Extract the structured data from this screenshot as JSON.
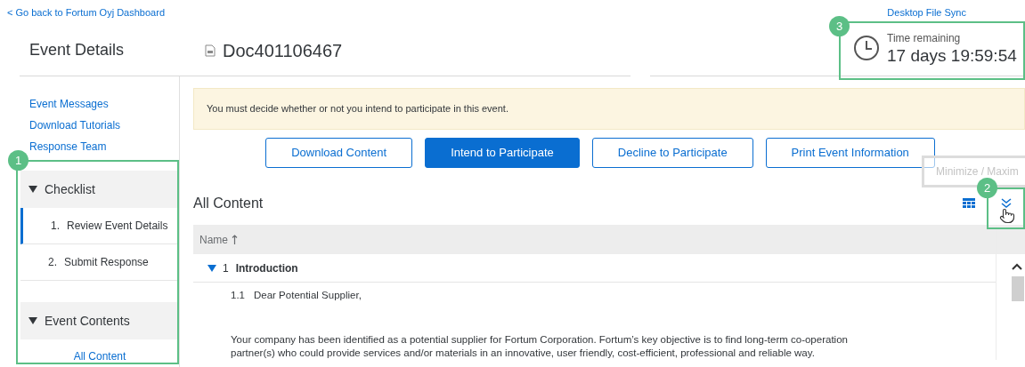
{
  "back_link": "< Go back to Fortum Oyj Dashboard",
  "desktop_sync_link": "Desktop File Sync",
  "page_title": "Event Details",
  "document": {
    "title": "Doc401106467"
  },
  "timer": {
    "label": "Time remaining",
    "value": "17 days 19:59:54"
  },
  "sidebar": {
    "links": [
      "Event Messages",
      "Download Tutorials",
      "Response Team"
    ],
    "sections": [
      {
        "title": "Checklist",
        "expanded": true,
        "items": [
          {
            "number": "1.",
            "label": "Review Event Details",
            "selected": true
          },
          {
            "number": "2.",
            "label": "Submit Response",
            "selected": false
          }
        ]
      },
      {
        "title": "Event Contents",
        "expanded": true,
        "items": [
          {
            "label": "All Content",
            "selected": false
          }
        ]
      }
    ]
  },
  "notice": "You must decide whether or not you intend to participate in this event.",
  "actions": [
    {
      "label": "Download Content",
      "primary": false
    },
    {
      "label": "Intend to Participate",
      "primary": true
    },
    {
      "label": "Decline to Participate",
      "primary": false
    },
    {
      "label": "Print Event Information",
      "primary": false
    }
  ],
  "content": {
    "title": "All Content",
    "column": {
      "label": "Name",
      "sorted": true
    },
    "rows": [
      {
        "number": "1",
        "title": "Introduction",
        "expanded": true,
        "children": [
          {
            "number": "1.1",
            "title": "Dear Potential Supplier,",
            "body": "Your company has been identified as a potential supplier for Fortum Corporation. Fortum’s key objective is to find long-term co-operation partner(s) who could provide services and/or materials in an innovative, user friendly,  cost-efficient, professional and reliable way."
          }
        ]
      }
    ]
  },
  "tooltip": "Minimize / Maxim",
  "callouts": [
    {
      "number": "1"
    },
    {
      "number": "2"
    },
    {
      "number": "3"
    }
  ]
}
